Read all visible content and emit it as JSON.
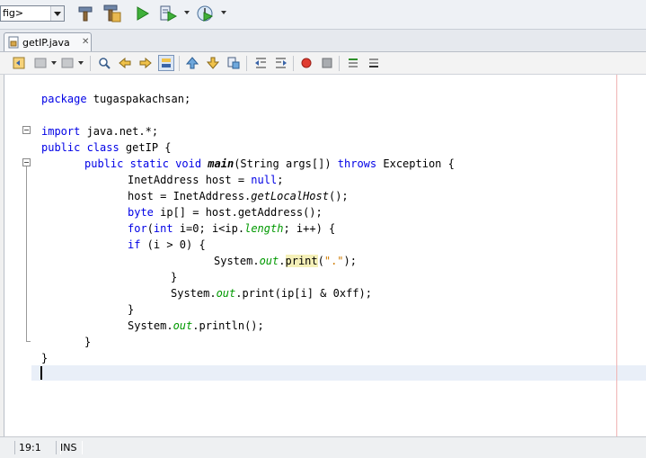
{
  "toolbar": {
    "config_combo_value": "fig>",
    "icons": [
      "clean-build-icon",
      "build-icon",
      "run-icon",
      "debug-icon",
      "profile-icon"
    ]
  },
  "tab": {
    "label": "getIP.java"
  },
  "code": {
    "l1_kw": "package",
    "l1_rest": " tugaspakachsan;",
    "l3_kw": "import",
    "l3_rest": " java.net.*;",
    "l4_kw": "public class",
    "l4_rest": " getIP {",
    "l5_kw1": "public static void",
    "l5_fn": "main",
    "l5_mid": "(String args[]) ",
    "l5_kw2": "throws",
    "l5_rest": " Exception {",
    "l6": "InetAddress host = ",
    "l6_kw": "null",
    "l6_end": ";",
    "l7_a": "host = InetAddress.",
    "l7_it": "getLocalHost",
    "l7_end": "();",
    "l8_kw": "byte",
    "l8_rest": " ip[] = host.getAddress();",
    "l9_kw1": "for",
    "l9_a": "(",
    "l9_kw2": "int",
    "l9_b": " i=0; i<ip.",
    "l9_fld": "length",
    "l9_c": "; i++) {",
    "l10_kw": "if",
    "l10_rest": " (i > 0) {",
    "l11_a": "System.",
    "l11_fld": "out",
    "l11_b": ".",
    "l11_hl": "print",
    "l11_c": "(",
    "l11_str": "\".\"",
    "l11_d": ");",
    "l12": "}",
    "l13_a": "System.",
    "l13_fld": "out",
    "l13_b": ".print(ip[i] & 0xff);",
    "l14": "}",
    "l15_a": "System.",
    "l15_fld": "out",
    "l15_b": ".println();",
    "l16": "}",
    "l17": "}"
  },
  "status": {
    "position": "19:1",
    "mode": "INS"
  }
}
